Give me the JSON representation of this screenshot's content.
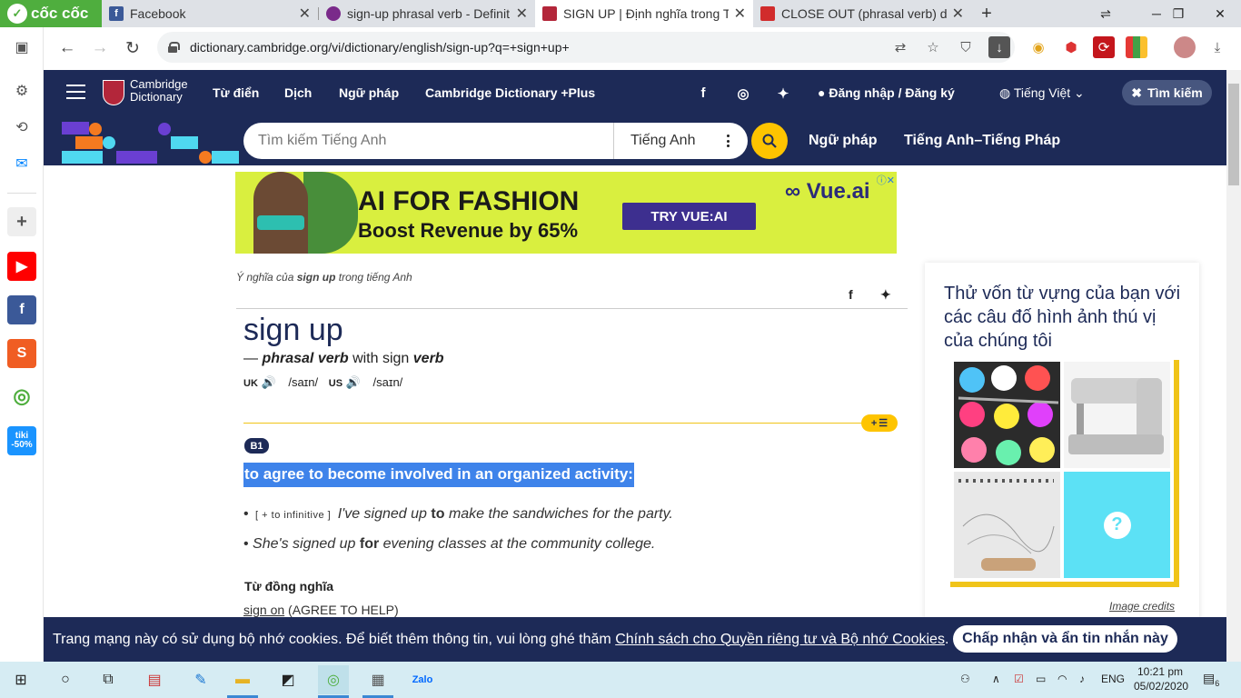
{
  "browser": {
    "tabs": [
      {
        "title": "Facebook"
      },
      {
        "title": "sign-up phrasal verb - Definit"
      },
      {
        "title": "SIGN UP | Định nghĩa trong T"
      },
      {
        "title": "CLOSE OUT (phrasal verb) def"
      }
    ],
    "new_tab": "+",
    "brand": "cốc cốc",
    "url": "dictionary.cambridge.org/vi/dictionary/english/sign-up?q=+sign+up+"
  },
  "site": {
    "brand_line1": "Cambridge",
    "brand_line2": "Dictionary",
    "nav": [
      "Từ điển",
      "Dịch",
      "Ngữ pháp",
      "Cambridge Dictionary +Plus"
    ],
    "login": "Đăng nhập / Đăng ký",
    "language": "Tiếng Việt",
    "search_toggle": "Tìm kiếm",
    "search_placeholder": "Tìm kiếm Tiếng Anh",
    "dictionary_select": "Tiếng Anh",
    "band_links": [
      "Ngữ pháp",
      "Tiếng Anh–Tiếng Pháp"
    ]
  },
  "ad": {
    "headline": "AI FOR FASHION",
    "subline": "Boost Revenue by 65%",
    "cta": "TRY VUE:AI",
    "brand": "Vue.ai"
  },
  "entry": {
    "breadcrumb_prefix": "Ý nghĩa của",
    "breadcrumb_word": "sign up",
    "breadcrumb_suffix": "trong tiếng Anh",
    "headword": "sign up",
    "pos_dash": "—",
    "pos": "phrasal verb",
    "pos_with": "with sign",
    "pos_base": "verb",
    "uk_label": "UK",
    "uk_ipa": "/saɪn/",
    "us_label": "US",
    "us_ipa": "/saɪn/",
    "add_list": "+",
    "level": "B1",
    "definition": "to agree to become involved in an organized activity:",
    "examples": [
      {
        "grammar": "[ + to infinitive ]",
        "before": "I've signed up",
        "keyword": "to",
        "after": "make the sandwiches for the party."
      },
      {
        "grammar": "",
        "before": "She's signed up",
        "keyword": "for",
        "after": "evening classes at the community college."
      }
    ],
    "synonyms_heading": "Từ đồng nghĩa",
    "synonym_word": "sign on",
    "synonym_sense": "(AGREE TO HELP)"
  },
  "quiz": {
    "title": "Thử vốn từ vựng của bạn với các câu đố hình ảnh thú vị của chúng tôi",
    "mystery": "?",
    "credits": "Image credits"
  },
  "cookie": {
    "text": "Trang mạng này có sử dụng bộ nhớ cookies. Để biết thêm thông tin, vui lòng ghé thăm",
    "link": "Chính sách cho Quyền riêng tư và Bộ nhớ Cookies",
    "end": ".",
    "button": "Chấp nhận và ẩn tin nhắn này"
  },
  "taskbar": {
    "language": "ENG",
    "time": "10:21 pm",
    "date": "05/02/2020",
    "notifications": "6"
  },
  "colors": {
    "navy": "#1d2a57",
    "gold": "#fec400",
    "highlight": "#3e83ea"
  }
}
